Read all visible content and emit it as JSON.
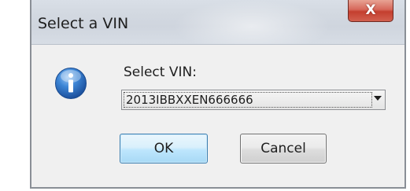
{
  "window": {
    "title": "Select a VIN",
    "close_glyph": "X"
  },
  "dialog": {
    "icon": "info-icon",
    "prompt": "Select VIN:",
    "vin_select": {
      "selected_value": "2013IBBXXEN666666"
    },
    "ok_label": "OK",
    "cancel_label": "Cancel"
  },
  "colors": {
    "close_button": "#c43f2f",
    "info_icon": "#2f72c4",
    "ok_button_border": "#3c7fb1"
  }
}
